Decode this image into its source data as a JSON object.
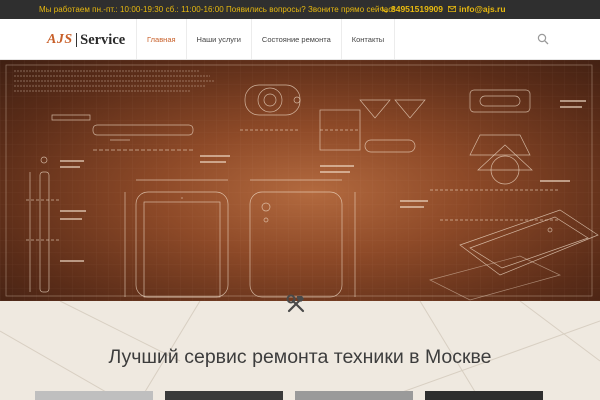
{
  "topbar": {
    "schedule": "Мы работаем пн.-пт.: 10:00-19:30 сб.: 11:00-16:00 Появились вопросы? Звоните прямо сейчас!",
    "phone": "84951519909",
    "email": "info@ajs.ru",
    "phone_icon": "phone-icon",
    "email_icon": "envelope-icon"
  },
  "logo": {
    "brand": "AJS",
    "name": "Service"
  },
  "nav": {
    "items": [
      {
        "label": "Главная"
      },
      {
        "label": "Наши услуги"
      },
      {
        "label": "Состояние ремонта"
      },
      {
        "label": "Контакты"
      }
    ],
    "search_icon": "search-icon"
  },
  "hero": {
    "image": "smartphone-blueprint-schematic"
  },
  "section": {
    "icon": "hammer-wrench-icon",
    "headline": "Лучший сервис ремонта техники в Москве"
  },
  "colors": {
    "accent": "#c8602a",
    "topbar_bg": "#2f2f2f",
    "topbar_text": "#e8b90f"
  }
}
